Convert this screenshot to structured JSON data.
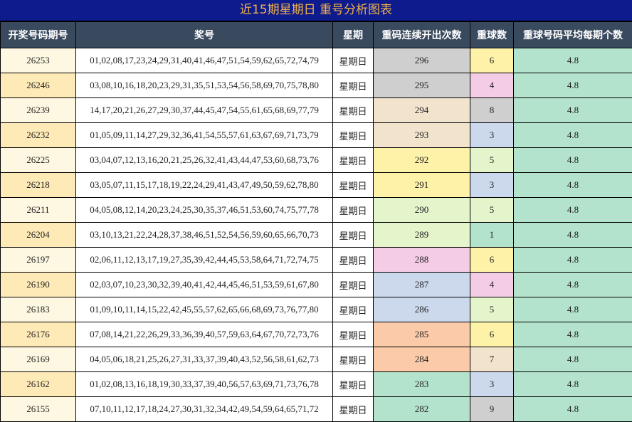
{
  "title": "近15期星期日 重号分析图表",
  "headers": [
    "开奖号码期号",
    "奖号",
    "星期",
    "重码连续开出次数",
    "重球数",
    "重球号码平均每期个数"
  ],
  "colors": {
    "title_bg": "#0d1b8c",
    "title_text": "#f2b24a",
    "header_bg": "#3a4a5e",
    "row_even": "#fef8e2",
    "row_odd": "#feeab6",
    "avg_bg": "#b3e3cd"
  },
  "rows": [
    {
      "period": "26253",
      "numbers": "01,02,08,17,23,24,29,31,40,41,46,47,51,54,59,62,65,72,74,79",
      "weekday": "星期日",
      "repeat_count": "296",
      "repeat_count_color": "#cfcfcf",
      "balls": "6",
      "balls_color": "#fdf2a8",
      "avg": "4.8"
    },
    {
      "period": "26246",
      "numbers": "03,08,10,16,18,20,23,29,31,35,51,53,54,56,58,69,70,75,78,80",
      "weekday": "星期日",
      "repeat_count": "295",
      "repeat_count_color": "#cfcfcf",
      "balls": "4",
      "balls_color": "#f4cce5",
      "avg": "4.8"
    },
    {
      "period": "26239",
      "numbers": "14,17,20,21,26,27,29,30,37,44,45,47,54,55,61,65,68,69,77,79",
      "weekday": "星期日",
      "repeat_count": "294",
      "repeat_count_color": "#f2e3cd",
      "balls": "8",
      "balls_color": "#cfcfcf",
      "avg": "4.8"
    },
    {
      "period": "26232",
      "numbers": "01,05,09,11,14,27,29,32,36,41,54,55,57,61,63,67,69,71,73,79",
      "weekday": "星期日",
      "repeat_count": "293",
      "repeat_count_color": "#f2e3cd",
      "balls": "3",
      "balls_color": "#ccd9ec",
      "avg": "4.8"
    },
    {
      "period": "26225",
      "numbers": "03,04,07,12,13,16,20,21,25,26,32,41,43,44,47,53,60,68,73,76",
      "weekday": "星期日",
      "repeat_count": "292",
      "repeat_count_color": "#fdf2a8",
      "balls": "5",
      "balls_color": "#e4f4cb",
      "avg": "4.8"
    },
    {
      "period": "26218",
      "numbers": "03,05,07,11,15,17,18,19,22,24,29,41,43,47,49,50,59,62,78,80",
      "weekday": "星期日",
      "repeat_count": "291",
      "repeat_count_color": "#fdf2a8",
      "balls": "3",
      "balls_color": "#ccd9ec",
      "avg": "4.8"
    },
    {
      "period": "26211",
      "numbers": "04,05,08,12,14,20,23,24,25,30,35,37,46,51,53,60,74,75,77,78",
      "weekday": "星期日",
      "repeat_count": "290",
      "repeat_count_color": "#e4f4cb",
      "balls": "5",
      "balls_color": "#e4f4cb",
      "avg": "4.8"
    },
    {
      "period": "26204",
      "numbers": "03,10,13,21,22,24,28,37,38,46,51,52,54,56,59,60,65,66,70,73",
      "weekday": "星期日",
      "repeat_count": "289",
      "repeat_count_color": "#e4f4cb",
      "balls": "1",
      "balls_color": "#b3e3cd",
      "avg": "4.8"
    },
    {
      "period": "26197",
      "numbers": "02,06,11,12,13,17,19,27,35,39,42,44,45,53,58,64,71,72,74,75",
      "weekday": "星期日",
      "repeat_count": "288",
      "repeat_count_color": "#f4cce5",
      "balls": "6",
      "balls_color": "#fdf2a8",
      "avg": "4.8"
    },
    {
      "period": "26190",
      "numbers": "02,03,07,10,23,30,32,39,40,41,42,44,45,46,51,53,59,61,67,80",
      "weekday": "星期日",
      "repeat_count": "287",
      "repeat_count_color": "#ccd9ec",
      "balls": "4",
      "balls_color": "#f4cce5",
      "avg": "4.8"
    },
    {
      "period": "26183",
      "numbers": "01,09,10,11,14,15,22,42,45,55,57,62,65,66,68,69,73,76,77,80",
      "weekday": "星期日",
      "repeat_count": "286",
      "repeat_count_color": "#ccd9ec",
      "balls": "5",
      "balls_color": "#e4f4cb",
      "avg": "4.8"
    },
    {
      "period": "26176",
      "numbers": "07,08,14,21,22,26,29,33,36,39,40,57,59,63,64,67,70,72,73,76",
      "weekday": "星期日",
      "repeat_count": "285",
      "repeat_count_color": "#fbcba9",
      "balls": "6",
      "balls_color": "#fdf2a8",
      "avg": "4.8"
    },
    {
      "period": "26169",
      "numbers": "04,05,06,18,21,25,26,27,31,33,37,39,40,43,52,56,58,61,62,73",
      "weekday": "星期日",
      "repeat_count": "284",
      "repeat_count_color": "#fbcba9",
      "balls": "7",
      "balls_color": "#f2e3cd",
      "avg": "4.8"
    },
    {
      "period": "26162",
      "numbers": "01,02,08,13,16,18,19,30,33,37,39,40,56,57,63,69,71,73,76,78",
      "weekday": "星期日",
      "repeat_count": "283",
      "repeat_count_color": "#b3e3cd",
      "balls": "3",
      "balls_color": "#ccd9ec",
      "avg": "4.8"
    },
    {
      "period": "26155",
      "numbers": "07,10,11,12,17,18,24,27,30,31,32,34,42,49,54,59,64,65,71,72",
      "weekday": "星期日",
      "repeat_count": "282",
      "repeat_count_color": "#b3e3cd",
      "balls": "9",
      "balls_color": "#cfcfcf",
      "avg": "4.8"
    }
  ]
}
